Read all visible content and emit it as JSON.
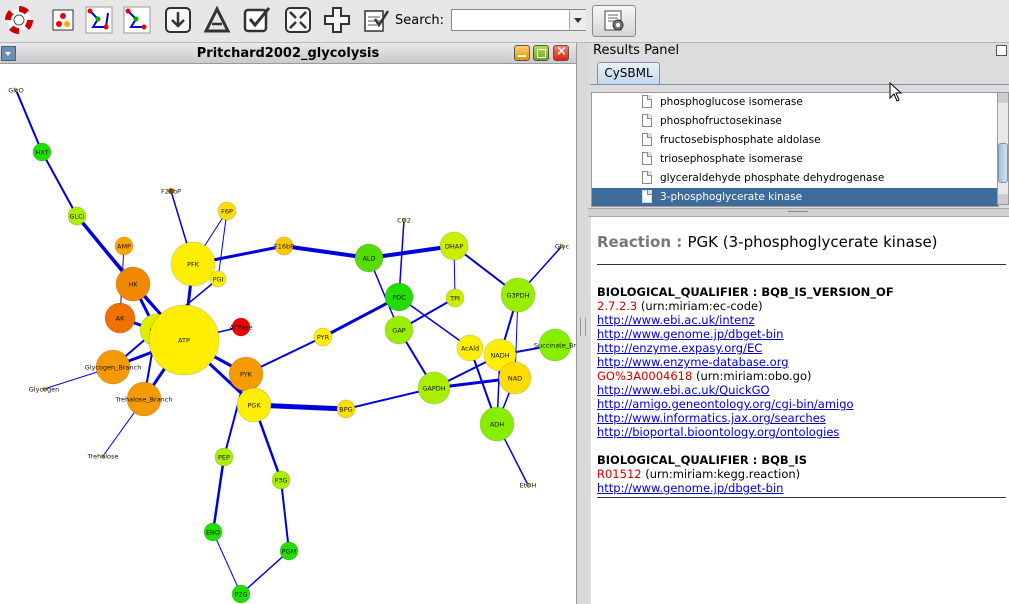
{
  "toolbar": {
    "search_label": "Search:",
    "search_value": "",
    "icons": [
      "lifebuoy-icon",
      "layout-icon",
      "network-import-icon",
      "network-export-icon",
      "download-icon",
      "annotate-a-icon",
      "check-icon",
      "zoom-fit-icon",
      "zoom-in-icon",
      "checklist-icon",
      "settings-icon"
    ]
  },
  "network": {
    "title": "Pritchard2002_glycolysis",
    "colors": {
      "green": "#22dd00",
      "lime": "#aaee00",
      "yellow": "#ffee00",
      "orange": "#ffa500",
      "dark_orange": "#f07800",
      "red": "#ee0000",
      "edge": "#0000dd"
    },
    "nodes": [
      {
        "id": "GlcO",
        "label": "GlcO",
        "color": "#ccaa33"
      },
      {
        "id": "HXT",
        "label": "HXT",
        "color": "#22dd00"
      },
      {
        "id": "F26bP",
        "label": "F26bP",
        "color": "#aa6600"
      },
      {
        "id": "GLCi",
        "label": "GLCi",
        "color": "#aaee00"
      },
      {
        "id": "F6P",
        "label": "F6P",
        "color": "#ffdd00"
      },
      {
        "id": "AMP",
        "label": "AMP",
        "color": "#ffa500"
      },
      {
        "id": "PFK",
        "label": "PFK",
        "color": "#ffee00"
      },
      {
        "id": "PGI",
        "label": "PGI",
        "color": "#ffee00"
      },
      {
        "id": "HK",
        "label": "HK",
        "color": "#f08800"
      },
      {
        "id": "AK",
        "label": "AK",
        "color": "#f07000"
      },
      {
        "id": "G6P",
        "label": "G6P",
        "color": "#ddee00"
      },
      {
        "id": "ATP",
        "label": "ATP",
        "color": "#ffee00"
      },
      {
        "id": "ATPase",
        "label": "ATPase",
        "color": "#ee0000"
      },
      {
        "id": "Glycogen_Branch",
        "label": "Glycogen_Branch",
        "color": "#f59a00"
      },
      {
        "id": "Glycogen",
        "label": "Glycogen",
        "color": "#ccaa33"
      },
      {
        "id": "Trehalose_Branch",
        "label": "Trehalose_Branch",
        "color": "#f59a00"
      },
      {
        "id": "Trehalose",
        "label": "Trehalose",
        "color": "#ccaa33"
      },
      {
        "id": "F16bP",
        "label": "F16bP",
        "color": "#ffc800"
      },
      {
        "id": "ALD",
        "label": "ALD",
        "color": "#55dd00"
      },
      {
        "id": "CO2",
        "label": "CO2",
        "color": "#ccaa33"
      },
      {
        "id": "DHAP",
        "label": "DHAP",
        "color": "#ccee00"
      },
      {
        "id": "Glyc",
        "label": "Glyc",
        "color": "#ccaa33"
      },
      {
        "id": "PDC",
        "label": "PDC",
        "color": "#22dd00"
      },
      {
        "id": "TPI",
        "label": "TPI",
        "color": "#ccee00"
      },
      {
        "id": "G3PDH",
        "label": "G3PDH",
        "color": "#99ee00"
      },
      {
        "id": "PYR",
        "label": "PYR",
        "color": "#ffee00"
      },
      {
        "id": "GAP",
        "label": "GAP",
        "color": "#99ee00"
      },
      {
        "id": "AcAld",
        "label": "AcAld",
        "color": "#ffee00"
      },
      {
        "id": "NADH",
        "label": "NADH",
        "color": "#ffee00"
      },
      {
        "id": "Succinate_Branch",
        "label": "Succinate_Br",
        "color": "#88ee00"
      },
      {
        "id": "NAD",
        "label": "NAD",
        "color": "#ffdd00"
      },
      {
        "id": "PYK",
        "label": "PYK",
        "color": "#f59a00"
      },
      {
        "id": "PGK",
        "label": "PGK",
        "color": "#ffee00"
      },
      {
        "id": "BPG",
        "label": "BPG",
        "color": "#ffdd00"
      },
      {
        "id": "GAPDH",
        "label": "GAPDH",
        "color": "#aaee00"
      },
      {
        "id": "ADH",
        "label": "ADH",
        "color": "#88ee00"
      },
      {
        "id": "EtOH",
        "label": "EtOH",
        "color": "#ccaa33"
      },
      {
        "id": "PEP",
        "label": "PEP",
        "color": "#aaee00"
      },
      {
        "id": "P3G",
        "label": "P3G",
        "color": "#aaee00"
      },
      {
        "id": "ENO",
        "label": "ENO",
        "color": "#22dd00"
      },
      {
        "id": "PGM",
        "label": "PGM",
        "color": "#22dd00"
      },
      {
        "id": "P2G",
        "label": "P2G",
        "color": "#22dd00"
      }
    ]
  },
  "results": {
    "title": "Results Panel",
    "tab": "CySBML",
    "tree_items": [
      {
        "label": "phosphoglucose isomerase",
        "selected": false
      },
      {
        "label": "phosphofructosekinase",
        "selected": false
      },
      {
        "label": "fructosebisphosphate aldolase",
        "selected": false
      },
      {
        "label": "triosephosphate isomerase",
        "selected": false
      },
      {
        "label": "glyceraldehyde phosphate dehydrogenase",
        "selected": false
      },
      {
        "label": "3-phosphoglycerate kinase",
        "selected": true
      }
    ],
    "reaction_key": "Reaction",
    "reaction_sep": " : ",
    "reaction_value": "PGK (3-phosphoglycerate kinase)",
    "q1": {
      "title": "BIOLOGICAL_QUALIFIER : BQB_IS_VERSION_OF",
      "lines": [
        {
          "red": "2.7.2.3",
          "rest": " (urn:miriam:ec-code)"
        },
        {
          "link": "http://www.ebi.ac.uk/intenz"
        },
        {
          "link": "http://www.genome.jp/dbget-bin"
        },
        {
          "link": "http://enzyme.expasy.org/EC"
        },
        {
          "link": "http://www.enzyme-database.org"
        },
        {
          "red": "GO%3A0004618",
          "rest": " (urn:miriam:obo.go)"
        },
        {
          "link": "http://www.ebi.ac.uk/QuickGO"
        },
        {
          "link": "http://amigo.geneontology.org/cgi-bin/amigo"
        },
        {
          "link": "http://www.informatics.jax.org/searches"
        },
        {
          "link": "http://bioportal.bioontology.org/ontologies"
        }
      ]
    },
    "q2": {
      "title": "BIOLOGICAL_QUALIFIER : BQB_IS",
      "lines": [
        {
          "red": "R01512",
          "rest": " (urn:miriam:kegg.reaction)"
        },
        {
          "link": "http://www.genome.jp/dbget-bin"
        }
      ]
    }
  }
}
